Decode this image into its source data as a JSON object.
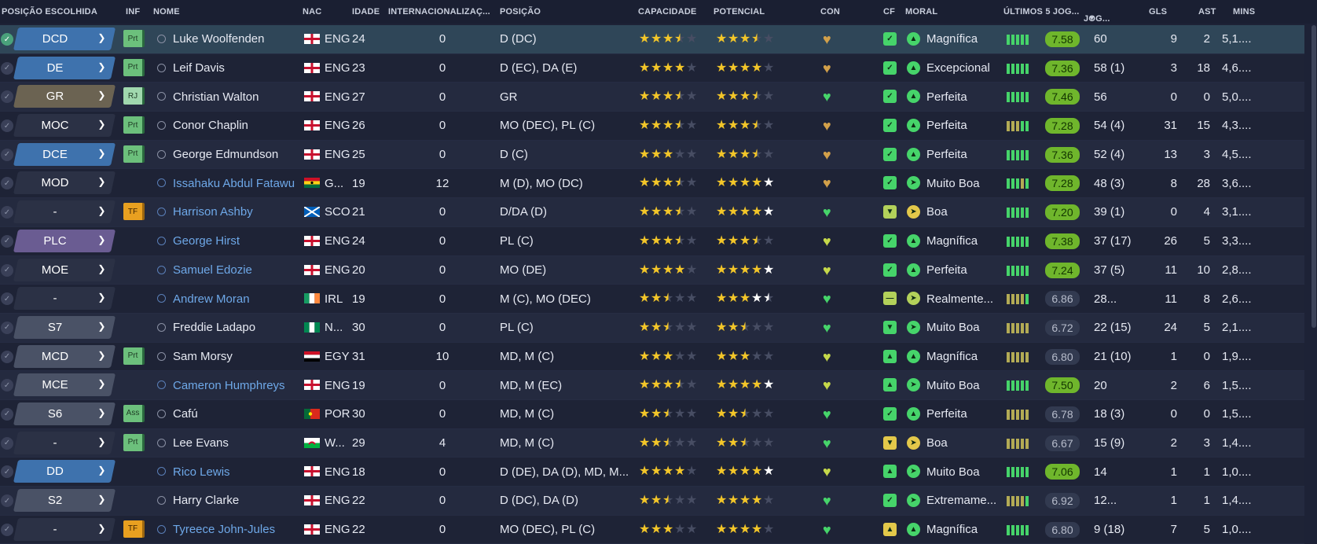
{
  "header": {
    "pos_chosen": "POSIÇÃO ESCOLHIDA",
    "inf": "INF",
    "name": "NOME",
    "nat": "NAC",
    "age": "IDADE",
    "intl": "INTERNACIONALIZAÇ...",
    "position": "POSIÇÃO",
    "ability": "CAPACIDADE",
    "potential": "POTENCIAL",
    "con": "CON",
    "cf": "CF",
    "morale": "MORAL",
    "last5": "ÚLTIMOS 5 JOG...",
    "games": "JOG...",
    "sort_arrow": "▼",
    "goals": "GLS",
    "assists": "AST",
    "mins": "MINS"
  },
  "colors": {
    "pos_blue": "#3e72ad",
    "pos_brown": "#6b6352",
    "pos_gray": "#4a5266",
    "pos_dark": "#2b3145",
    "pos_purple": "#6a5c92",
    "rating_good": "#6fb62c",
    "star": "#f3c629",
    "heart_green": "#46d46a",
    "heart_gold": "#d2a04a"
  },
  "players": [
    {
      "sel": "DCD",
      "selColor": "#3e72ad",
      "inf": "Prt",
      "infType": "prt",
      "name": "Luke Woolfenden",
      "nameBlue": false,
      "flag": "eng",
      "nat": "ENG",
      "age": "24",
      "intl": "0",
      "pos": "D (DC)",
      "cap": 3.5,
      "pot": 3.5,
      "potWhite": 0,
      "con": "gold",
      "cf": "thumb",
      "cfColor": "#46d46a",
      "morIcon": "up",
      "morColor": "#46d46a",
      "morale": "Magnífica",
      "form": [
        "#46d46a",
        "#46d46a",
        "#46d46a",
        "#46d46a",
        "#46d46a"
      ],
      "rating": "7.58",
      "good": true,
      "apps": "60",
      "gls": "9",
      "ast": "2",
      "mins": "5,1....",
      "selected": true
    },
    {
      "sel": "DE",
      "selColor": "#3e72ad",
      "inf": "Prt",
      "infType": "prt",
      "name": "Leif Davis",
      "nameBlue": false,
      "flag": "eng",
      "nat": "ENG",
      "age": "23",
      "intl": "0",
      "pos": "D (EC), DA (E)",
      "cap": 4,
      "pot": 4,
      "potWhite": 0,
      "con": "gold",
      "cf": "thumb",
      "cfColor": "#46d46a",
      "morIcon": "up",
      "morColor": "#46d46a",
      "morale": "Excepcional",
      "form": [
        "#46d46a",
        "#46d46a",
        "#46d46a",
        "#46d46a",
        "#46d46a"
      ],
      "rating": "7.36",
      "good": true,
      "apps": "58 (1)",
      "gls": "3",
      "ast": "18",
      "mins": "4,6....",
      "selected": false
    },
    {
      "sel": "GR",
      "selColor": "#6b6352",
      "inf": "RJ",
      "infType": "rj",
      "name": "Christian Walton",
      "nameBlue": false,
      "flag": "eng",
      "nat": "ENG",
      "age": "27",
      "intl": "0",
      "pos": "GR",
      "cap": 3.5,
      "pot": 3.5,
      "potWhite": 0,
      "con": "green",
      "cf": "thumb",
      "cfColor": "#46d46a",
      "morIcon": "up",
      "morColor": "#46d46a",
      "morale": "Perfeita",
      "form": [
        "#46d46a",
        "#46d46a",
        "#46d46a",
        "#46d46a",
        "#46d46a"
      ],
      "rating": "7.46",
      "good": true,
      "apps": "56",
      "gls": "0",
      "ast": "0",
      "mins": "5,0....",
      "selected": false
    },
    {
      "sel": "MOC",
      "selColor": "#2b3145",
      "inf": "Prt",
      "infType": "prt",
      "name": "Conor Chaplin",
      "nameBlue": false,
      "flag": "eng",
      "nat": "ENG",
      "age": "26",
      "intl": "0",
      "pos": "MO (DEC), PL (C)",
      "cap": 3.5,
      "pot": 3.5,
      "potWhite": 0,
      "con": "gold",
      "cf": "thumb",
      "cfColor": "#46d46a",
      "morIcon": "up",
      "morColor": "#46d46a",
      "morale": "Perfeita",
      "form": [
        "#b3ab55",
        "#b3ab55",
        "#b3ab55",
        "#46d46a",
        "#46d46a"
      ],
      "rating": "7.28",
      "good": true,
      "apps": "54 (4)",
      "gls": "31",
      "ast": "15",
      "mins": "4,3....",
      "selected": false
    },
    {
      "sel": "DCE",
      "selColor": "#3e72ad",
      "inf": "Prt",
      "infType": "prt",
      "name": "George Edmundson",
      "nameBlue": false,
      "flag": "eng",
      "nat": "ENG",
      "age": "25",
      "intl": "0",
      "pos": "D (C)",
      "cap": 3,
      "pot": 3.5,
      "potWhite": 0,
      "con": "gold",
      "cf": "thumb",
      "cfColor": "#46d46a",
      "morIcon": "up",
      "morColor": "#46d46a",
      "morale": "Perfeita",
      "form": [
        "#46d46a",
        "#46d46a",
        "#46d46a",
        "#46d46a",
        "#46d46a"
      ],
      "rating": "7.36",
      "good": true,
      "apps": "52 (4)",
      "gls": "13",
      "ast": "3",
      "mins": "4,5....",
      "selected": false
    },
    {
      "sel": "MOD",
      "selColor": "#2b3145",
      "inf": "",
      "infType": "",
      "name": "Issahaku Abdul Fatawu",
      "nameBlue": true,
      "flag": "gha",
      "nat": "G...",
      "age": "19",
      "intl": "12",
      "pos": "M (D), MO (DC)",
      "cap": 3.5,
      "pot": 4,
      "potWhite": 1,
      "con": "gold",
      "cf": "thumb",
      "cfColor": "#46d46a",
      "morIcon": "right",
      "morColor": "#46d46a",
      "morale": "Muito Boa",
      "form": [
        "#46d46a",
        "#46d46a",
        "#46d46a",
        "#b3ab55",
        "#46d46a"
      ],
      "rating": "7.28",
      "good": true,
      "apps": "48 (3)",
      "gls": "8",
      "ast": "28",
      "mins": "3,6....",
      "selected": false
    },
    {
      "sel": "-",
      "selColor": "#2b3145",
      "inf": "TF",
      "infType": "tf",
      "name": "Harrison Ashby",
      "nameBlue": true,
      "flag": "sco",
      "nat": "SCO",
      "age": "21",
      "intl": "0",
      "pos": "D/DA (D)",
      "cap": 3.5,
      "pot": 4,
      "potWhite": 1,
      "con": "green",
      "cf": "down",
      "cfColor": "#b3d15a",
      "morIcon": "right",
      "morColor": "#e3c84a",
      "morale": "Boa",
      "form": [
        "#46d46a",
        "#46d46a",
        "#46d46a",
        "#46d46a",
        "#46d46a"
      ],
      "rating": "7.20",
      "good": true,
      "apps": "39 (1)",
      "gls": "0",
      "ast": "4",
      "mins": "3,1....",
      "selected": false
    },
    {
      "sel": "PLC",
      "selColor": "#6a5c92",
      "inf": "",
      "infType": "",
      "name": "George Hirst",
      "nameBlue": true,
      "flag": "eng",
      "nat": "ENG",
      "age": "24",
      "intl": "0",
      "pos": "PL (C)",
      "cap": 3.5,
      "pot": 3.5,
      "potWhite": 0,
      "con": "lime",
      "cf": "thumb",
      "cfColor": "#46d46a",
      "morIcon": "up",
      "morColor": "#46d46a",
      "morale": "Magnífica",
      "form": [
        "#46d46a",
        "#46d46a",
        "#46d46a",
        "#46d46a",
        "#46d46a"
      ],
      "rating": "7.38",
      "good": true,
      "apps": "37 (17)",
      "gls": "26",
      "ast": "5",
      "mins": "3,3....",
      "selected": false
    },
    {
      "sel": "MOE",
      "selColor": "#2b3145",
      "inf": "",
      "infType": "",
      "name": "Samuel Edozie",
      "nameBlue": true,
      "flag": "eng",
      "nat": "ENG",
      "age": "20",
      "intl": "0",
      "pos": "MO (DE)",
      "cap": 4,
      "pot": 4,
      "potWhite": 1,
      "con": "lime",
      "cf": "thumb",
      "cfColor": "#46d46a",
      "morIcon": "up",
      "morColor": "#46d46a",
      "morale": "Perfeita",
      "form": [
        "#46d46a",
        "#46d46a",
        "#46d46a",
        "#46d46a",
        "#46d46a"
      ],
      "rating": "7.24",
      "good": true,
      "apps": "37 (5)",
      "gls": "11",
      "ast": "10",
      "mins": "2,8....",
      "selected": false
    },
    {
      "sel": "-",
      "selColor": "#2b3145",
      "inf": "",
      "infType": "",
      "name": "Andrew Moran",
      "nameBlue": true,
      "flag": "irl",
      "nat": "IRL",
      "age": "19",
      "intl": "0",
      "pos": "M (C), MO (DEC)",
      "cap": 2.5,
      "pot": 3,
      "potWhite": 1.5,
      "con": "green",
      "cf": "minus",
      "cfColor": "#b3d15a",
      "morIcon": "right",
      "morColor": "#b3d15a",
      "morale": "Realmente...",
      "form": [
        "#b3ab55",
        "#b3ab55",
        "#b3ab55",
        "#b3ab55",
        "#46d46a"
      ],
      "rating": "6.86",
      "good": false,
      "apps": "28...",
      "gls": "11",
      "ast": "8",
      "mins": "2,6....",
      "selected": false
    },
    {
      "sel": "S7",
      "selColor": "#4a5266",
      "inf": "",
      "infType": "",
      "name": "Freddie Ladapo",
      "nameBlue": false,
      "flag": "nga",
      "nat": "N...",
      "age": "30",
      "intl": "0",
      "pos": "PL (C)",
      "cap": 2.5,
      "pot": 2.5,
      "potWhite": 0,
      "con": "green",
      "cf": "down",
      "cfColor": "#46d46a",
      "morIcon": "right",
      "morColor": "#46d46a",
      "morale": "Muito Boa",
      "form": [
        "#b3ab55",
        "#b3ab55",
        "#b3ab55",
        "#b3ab55",
        "#b3ab55"
      ],
      "rating": "6.72",
      "good": false,
      "apps": "22 (15)",
      "gls": "24",
      "ast": "5",
      "mins": "2,1....",
      "selected": false
    },
    {
      "sel": "MCD",
      "selColor": "#4a5266",
      "inf": "Prt",
      "infType": "prt",
      "name": "Sam Morsy",
      "nameBlue": false,
      "flag": "egy",
      "nat": "EGY",
      "age": "31",
      "intl": "10",
      "pos": "MD, M (C)",
      "cap": 3,
      "pot": 3,
      "potWhite": 0,
      "con": "lime",
      "cf": "up",
      "cfColor": "#46d46a",
      "morIcon": "up",
      "morColor": "#46d46a",
      "morale": "Magnífica",
      "form": [
        "#b3ab55",
        "#b3ab55",
        "#b3ab55",
        "#b3ab55",
        "#b3ab55"
      ],
      "rating": "6.80",
      "good": false,
      "apps": "21 (10)",
      "gls": "1",
      "ast": "0",
      "mins": "1,9....",
      "selected": false
    },
    {
      "sel": "MCE",
      "selColor": "#4a5266",
      "inf": "",
      "infType": "",
      "name": "Cameron Humphreys",
      "nameBlue": true,
      "flag": "eng",
      "nat": "ENG",
      "age": "19",
      "intl": "0",
      "pos": "MD, M (EC)",
      "cap": 3.5,
      "pot": 4,
      "potWhite": 1,
      "con": "lime",
      "cf": "up",
      "cfColor": "#46d46a",
      "morIcon": "right",
      "morColor": "#46d46a",
      "morale": "Muito Boa",
      "form": [
        "#46d46a",
        "#46d46a",
        "#46d46a",
        "#46d46a",
        "#46d46a"
      ],
      "rating": "7.50",
      "good": true,
      "apps": "20",
      "gls": "2",
      "ast": "6",
      "mins": "1,5....",
      "selected": false
    },
    {
      "sel": "S6",
      "selColor": "#4a5266",
      "inf": "Ass",
      "infType": "ass",
      "name": "Cafú",
      "nameBlue": false,
      "flag": "por",
      "nat": "POR",
      "age": "30",
      "intl": "0",
      "pos": "MD, M (C)",
      "cap": 2.5,
      "pot": 2.5,
      "potWhite": 0,
      "con": "green",
      "cf": "thumb",
      "cfColor": "#46d46a",
      "morIcon": "up",
      "morColor": "#46d46a",
      "morale": "Perfeita",
      "form": [
        "#b3ab55",
        "#b3ab55",
        "#b3ab55",
        "#b3ab55",
        "#b3ab55"
      ],
      "rating": "6.78",
      "good": false,
      "apps": "18 (3)",
      "gls": "0",
      "ast": "0",
      "mins": "1,5....",
      "selected": false
    },
    {
      "sel": "-",
      "selColor": "#2b3145",
      "inf": "Prt",
      "infType": "prt",
      "name": "Lee Evans",
      "nameBlue": false,
      "flag": "wal",
      "nat": "W...",
      "age": "29",
      "intl": "4",
      "pos": "MD, M (C)",
      "cap": 2.5,
      "pot": 2.5,
      "potWhite": 0,
      "con": "green",
      "cf": "down",
      "cfColor": "#e3c84a",
      "morIcon": "right",
      "morColor": "#e3c84a",
      "morale": "Boa",
      "form": [
        "#b3ab55",
        "#b3ab55",
        "#b3ab55",
        "#b3ab55",
        "#b3ab55"
      ],
      "rating": "6.67",
      "good": false,
      "apps": "15 (9)",
      "gls": "2",
      "ast": "3",
      "mins": "1,4....",
      "selected": false
    },
    {
      "sel": "DD",
      "selColor": "#3e72ad",
      "inf": "",
      "infType": "",
      "name": "Rico Lewis",
      "nameBlue": true,
      "flag": "eng",
      "nat": "ENG",
      "age": "18",
      "intl": "0",
      "pos": "D (DE), DA (D), MD, M...",
      "cap": 4,
      "pot": 4,
      "potWhite": 1,
      "con": "lime",
      "cf": "up",
      "cfColor": "#46d46a",
      "morIcon": "right",
      "morColor": "#46d46a",
      "morale": "Muito Boa",
      "form": [
        "#46d46a",
        "#46d46a",
        "#46d46a",
        "#46d46a",
        "#46d46a"
      ],
      "rating": "7.06",
      "good": true,
      "apps": "14",
      "gls": "1",
      "ast": "1",
      "mins": "1,0....",
      "selected": false
    },
    {
      "sel": "S2",
      "selColor": "#4a5266",
      "inf": "",
      "infType": "",
      "name": "Harry Clarke",
      "nameBlue": false,
      "flag": "eng",
      "nat": "ENG",
      "age": "22",
      "intl": "0",
      "pos": "D (DC), DA (D)",
      "cap": 2.5,
      "pot": 4,
      "potWhite": 0,
      "con": "green",
      "cf": "thumb",
      "cfColor": "#46d46a",
      "morIcon": "right",
      "morColor": "#46d46a",
      "morale": "Extremame...",
      "form": [
        "#b3ab55",
        "#b3ab55",
        "#b3ab55",
        "#b3ab55",
        "#46d46a"
      ],
      "rating": "6.92",
      "good": false,
      "apps": "12...",
      "gls": "1",
      "ast": "1",
      "mins": "1,4....",
      "selected": false
    },
    {
      "sel": "-",
      "selColor": "#2b3145",
      "inf": "TF",
      "infType": "tf",
      "name": "Tyreece John-Jules",
      "nameBlue": true,
      "flag": "eng",
      "nat": "ENG",
      "age": "22",
      "intl": "0",
      "pos": "MO (DEC), PL (C)",
      "cap": 3,
      "pot": 4,
      "potWhite": 0,
      "con": "green",
      "cf": "up",
      "cfColor": "#e3c84a",
      "morIcon": "up",
      "morColor": "#46d46a",
      "morale": "Magnífica",
      "form": [
        "#46d46a",
        "#46d46a",
        "#46d46a",
        "#46d46a",
        "#46d46a"
      ],
      "rating": "6.80",
      "good": false,
      "apps": "9 (18)",
      "gls": "7",
      "ast": "5",
      "mins": "1,0....",
      "selected": false
    }
  ]
}
